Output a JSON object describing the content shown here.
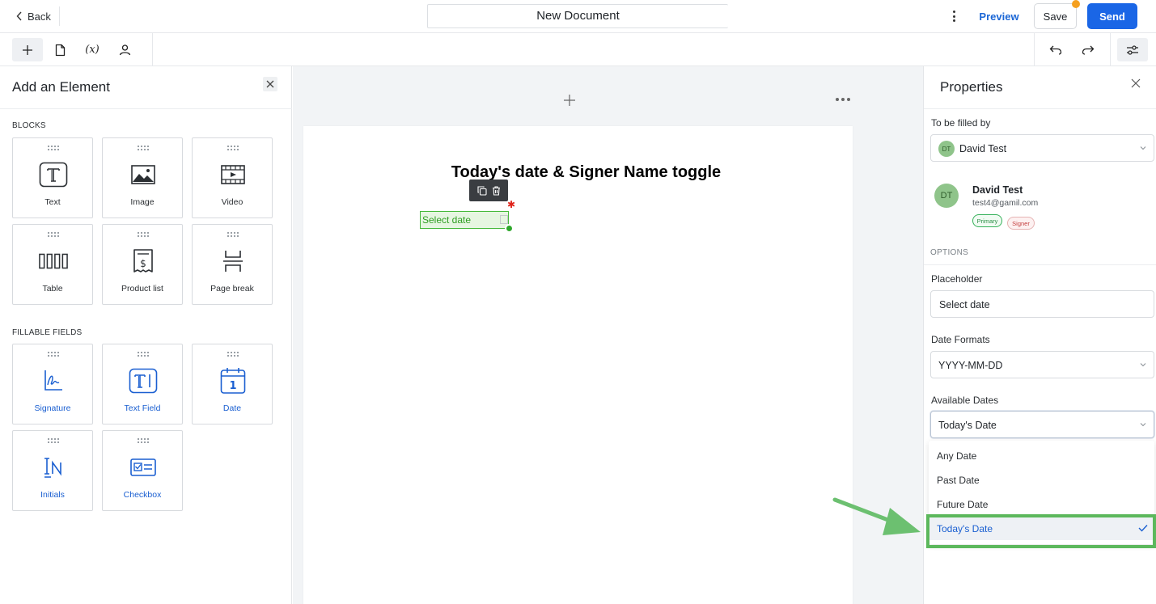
{
  "topbar": {
    "back_label": "Back",
    "document_title": "New Document",
    "preview_label": "Preview",
    "save_label": "Save",
    "send_label": "Send"
  },
  "left_panel": {
    "title": "Add an Element",
    "blocks_label": "BLOCKS",
    "blocks": [
      {
        "label": "Text",
        "icon": "text-block-icon"
      },
      {
        "label": "Image",
        "icon": "image-icon"
      },
      {
        "label": "Video",
        "icon": "video-icon"
      },
      {
        "label": "Table",
        "icon": "table-icon"
      },
      {
        "label": "Product list",
        "icon": "product-list-icon"
      },
      {
        "label": "Page break",
        "icon": "page-break-icon"
      }
    ],
    "fields_label": "FILLABLE FIELDS",
    "fields": [
      {
        "label": "Signature",
        "icon": "signature-icon"
      },
      {
        "label": "Text Field",
        "icon": "text-field-icon"
      },
      {
        "label": "Date",
        "icon": "calendar-icon"
      },
      {
        "label": "Initials",
        "icon": "initials-icon"
      },
      {
        "label": "Checkbox",
        "icon": "checkbox-icon"
      }
    ]
  },
  "canvas": {
    "heading": "Today's date & Signer Name toggle",
    "date_field_placeholder": "Select date"
  },
  "properties": {
    "title": "Properties",
    "filled_by_label": "To be filled by",
    "filled_by_value": "David Test",
    "filled_by_initials": "DT",
    "signer": {
      "initials": "DT",
      "name": "David Test",
      "email": "test4@gamil.com",
      "badge_primary": "Primary",
      "badge_signer": "Signer"
    },
    "options_label": "OPTIONS",
    "placeholder_label": "Placeholder",
    "placeholder_value": "Select date",
    "date_formats_label": "Date Formats",
    "date_format_value": "YYYY-MM-DD",
    "available_dates_label": "Available Dates",
    "available_dates_value": "Today's Date",
    "available_dates_options": [
      "Any Date",
      "Past Date",
      "Future Date",
      "Today's Date"
    ]
  },
  "colors": {
    "accent": "#1a66e6",
    "field_green": "#46b93a",
    "highlight_green": "#5cb85c",
    "required_red": "#e0241b",
    "notification_orange": "#f5a020"
  }
}
